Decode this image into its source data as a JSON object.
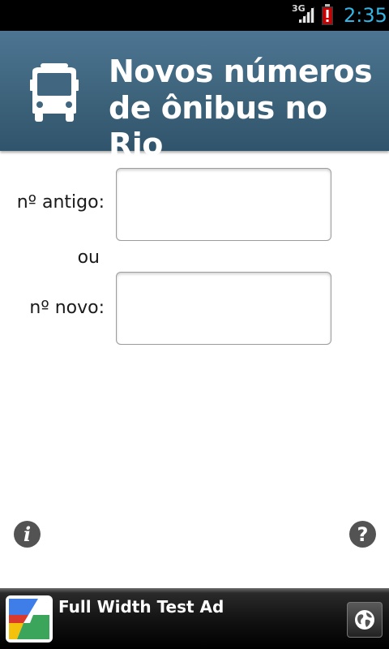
{
  "status_bar": {
    "network": "3G",
    "time": "2:35",
    "icons": [
      "signal-icon",
      "battery-alert-icon"
    ],
    "time_color": "#33b5e5"
  },
  "header": {
    "title_line1": "Novos números",
    "title_line2": "de ônibus no Rio",
    "icon": "bus-icon",
    "background": "#40677f"
  },
  "form": {
    "old_label": "nº antigo:",
    "or_label": "ou",
    "new_label": "nº novo:",
    "old_value": "",
    "new_value": ""
  },
  "footer_buttons": {
    "info": "i",
    "help": "?"
  },
  "ad": {
    "title": "Full Width Test Ad",
    "logo": "google-logo",
    "action_icon": "globe-icon"
  }
}
